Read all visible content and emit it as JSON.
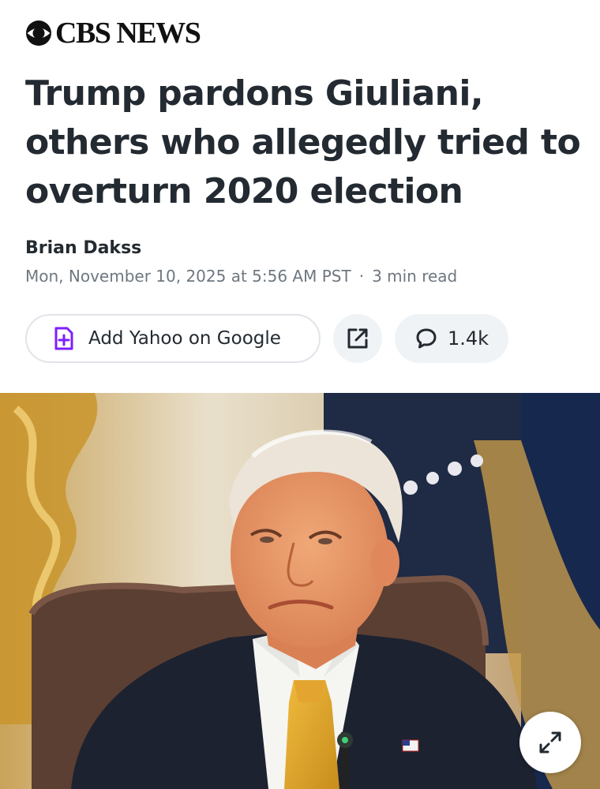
{
  "brand": {
    "name": "CBS NEWS",
    "icon": "cbs-eye-logo"
  },
  "article": {
    "headline": "Trump pardons Giuliani, others who allegedly tried to overturn 2020 election",
    "author": "Brian Dakss",
    "date": "Mon, November 10, 2025 at 5:56 AM PST",
    "separator": "·",
    "read_time": "3 min read"
  },
  "actions": {
    "add_google_label": "Add Yahoo on Google",
    "add_google_icon": "add-source-icon",
    "share_icon": "external-share-icon",
    "comments_icon": "comment-bubble-icon",
    "comments_count": "1.4k",
    "expand_icon": "expand-arrows-icon"
  },
  "colors": {
    "accent": "#7e1fff",
    "headline": "#232a31",
    "meta": "#6e7780",
    "pill_bg": "#f0f3f5",
    "pill_border": "#e0e4e9",
    "tie": "#e2a62b"
  }
}
